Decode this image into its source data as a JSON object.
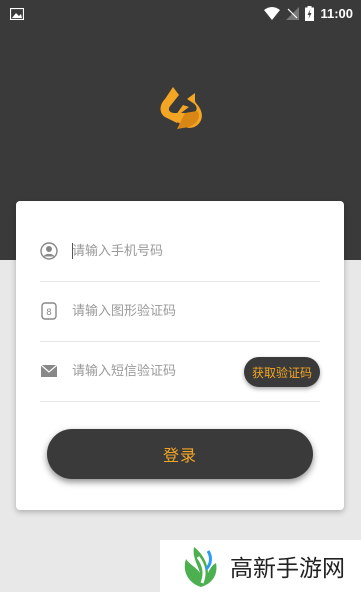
{
  "status_bar": {
    "time": "11:00",
    "icons": [
      "image-icon",
      "wifi-icon",
      "no-sim-icon",
      "battery-charging-icon"
    ]
  },
  "login": {
    "phone_placeholder": "请输入手机号码",
    "captcha_placeholder": "请输入图形验证码",
    "sms_placeholder": "请输入短信验证码",
    "get_code_label": "获取验证码",
    "login_label": "登录"
  },
  "watermark": {
    "text": "高新手游网"
  },
  "colors": {
    "header_bg": "#3a3a3a",
    "accent": "#f3a524",
    "page_bg": "#e8e8e8"
  }
}
